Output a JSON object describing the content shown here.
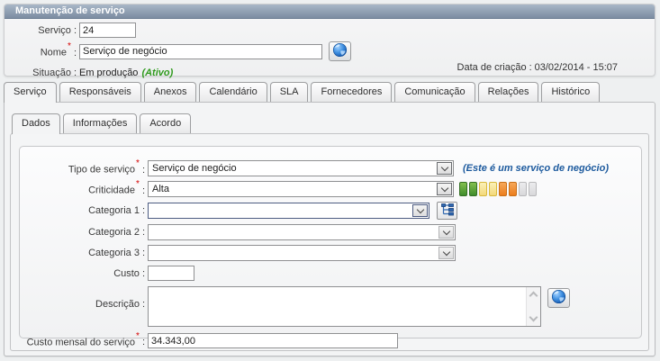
{
  "window": {
    "title": "Manutenção de serviço"
  },
  "ui": {
    "sep": ":"
  },
  "header": {
    "servico": {
      "label": "Serviço",
      "required": "",
      "value": "24"
    },
    "nome": {
      "label": "Nome",
      "required": "*",
      "value": "Serviço de negócio"
    },
    "situacao": {
      "label": "Situação",
      "value": "Em produção",
      "status": "(Ativo)"
    },
    "data_criacao": {
      "label": "Data de criação",
      "value": "03/02/2014 - 15:07"
    }
  },
  "tabs": {
    "main": [
      {
        "label": "Serviço",
        "active": true
      },
      {
        "label": "Responsáveis",
        "active": false
      },
      {
        "label": "Anexos",
        "active": false
      },
      {
        "label": "Calendário",
        "active": false
      },
      {
        "label": "SLA",
        "active": false
      },
      {
        "label": "Fornecedores",
        "active": false
      },
      {
        "label": "Comunicação",
        "active": false
      },
      {
        "label": "Relações",
        "active": false
      },
      {
        "label": "Histórico",
        "active": false
      }
    ],
    "inner": [
      {
        "label": "Dados",
        "active": true
      },
      {
        "label": "Informações",
        "active": false
      },
      {
        "label": "Acordo",
        "active": false
      }
    ]
  },
  "form": {
    "tipo_servico": {
      "label": "Tipo de serviço",
      "required": "*",
      "value": "Serviço de negócio",
      "note": "(Este é um serviço de negócio)"
    },
    "criticidade": {
      "label": "Criticidade",
      "required": "*",
      "value": "Alta",
      "bars": [
        "green",
        "green",
        "yellow",
        "yellow",
        "orange",
        "orange",
        "gray",
        "gray"
      ]
    },
    "categoria1": {
      "label": "Categoria 1",
      "required": "",
      "value": ""
    },
    "categoria2": {
      "label": "Categoria 2",
      "required": "",
      "value": ""
    },
    "categoria3": {
      "label": "Categoria 3",
      "required": "",
      "value": ""
    },
    "custo": {
      "label": "Custo",
      "required": "",
      "value": ""
    },
    "descricao": {
      "label": "Descrição",
      "required": "",
      "value": ""
    },
    "custo_mensal": {
      "label": "Custo mensal do serviço",
      "required": "*",
      "value": "34.343,00"
    }
  },
  "colors": {
    "title_bar_top": "#a9b7c7",
    "title_bar_bottom": "#7b8ca1",
    "note_blue": "#1d5a9e",
    "status_green": "#2f9a1d",
    "required_red": "#d40000",
    "bar_green": "#3f8c2a",
    "bar_yellow": "#f3d97a",
    "bar_orange": "#ec7d1c",
    "bar_gray": "#d8d8da"
  }
}
